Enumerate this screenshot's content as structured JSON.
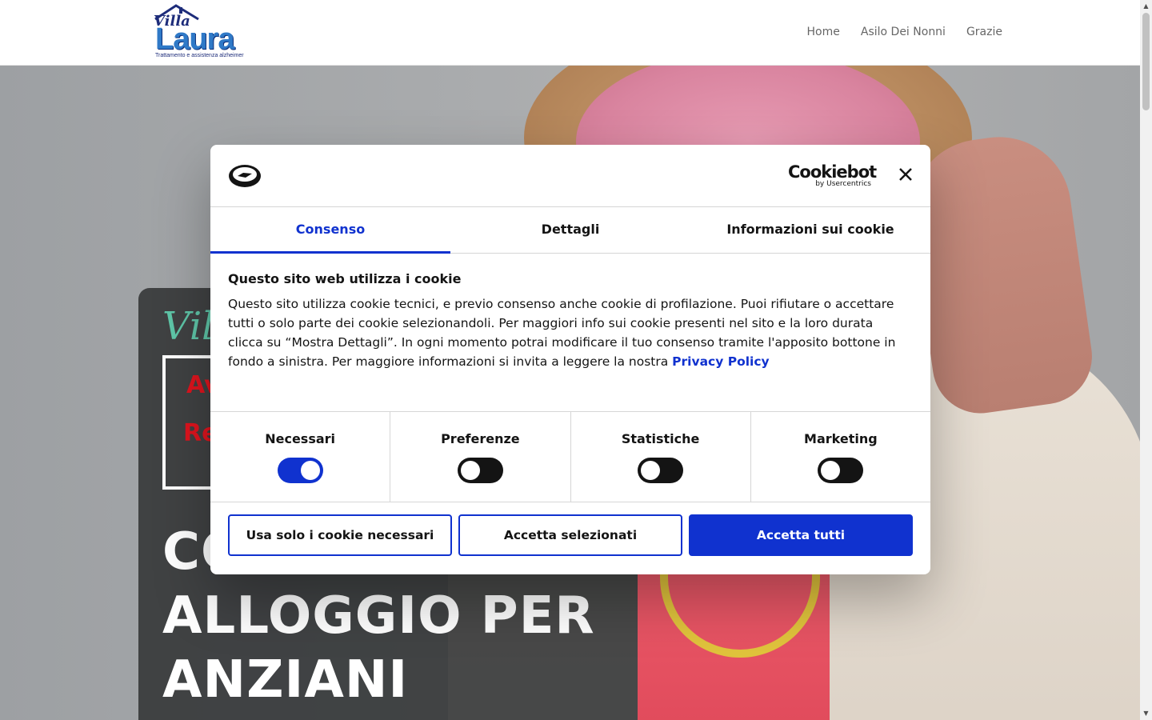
{
  "header": {
    "logo": {
      "villa": "Villa",
      "laura": "Laura",
      "tagline": "Trattamento e assistenza alzheimer"
    },
    "nav": [
      "Home",
      "Asilo Dei Nonni",
      "Grazie"
    ]
  },
  "hero": {
    "script_text": "Villa",
    "box_line1": "Av",
    "box_line2": "Re",
    "heading_lines": [
      "CO",
      "ALLOGGIO PER",
      "ANZIANI"
    ]
  },
  "cookie_dialog": {
    "brand_name": "Cookiebot",
    "brand_by": "by Usercentrics",
    "tabs": [
      {
        "label": "Consenso",
        "active": true
      },
      {
        "label": "Dettagli",
        "active": false
      },
      {
        "label": "Informazioni sui cookie",
        "active": false
      }
    ],
    "title": "Questo sito web utilizza i cookie",
    "body_text": "Questo sito utilizza cookie tecnici, e previo consenso anche cookie di profilazione. Puoi rifiutare o accettare tutti o solo parte dei cookie selezionandoli. Per maggiori info sui cookie presenti nel sito e la loro durata clicca su “Mostra Dettagli”. In ogni momento potrai modificare il tuo consenso tramite l'apposito bottone in fondo a sinistra. Per maggiore informazioni si invita a leggere la nostra ",
    "privacy_link": "Privacy Policy",
    "toggles": [
      {
        "label": "Necessari",
        "on": true
      },
      {
        "label": "Preferenze",
        "on": false
      },
      {
        "label": "Statistiche",
        "on": false
      },
      {
        "label": "Marketing",
        "on": false
      }
    ],
    "buttons": {
      "necessary_only": "Usa solo i cookie necessari",
      "accept_selected": "Accetta selezionati",
      "accept_all": "Accetta tutti"
    }
  },
  "colors": {
    "accent": "#1032cf",
    "dark": "#141414",
    "logo_blue": "#2f79c7",
    "hero_red": "#e0141e"
  }
}
